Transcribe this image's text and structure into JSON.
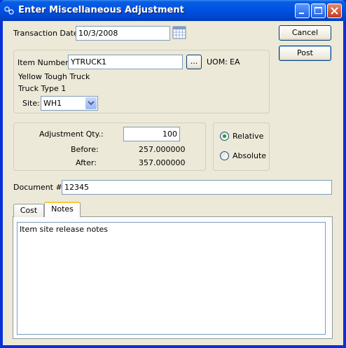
{
  "window": {
    "title": "Enter Miscellaneous Adjustment"
  },
  "transaction_date": {
    "label": "Transaction Date:",
    "value": "10/3/2008"
  },
  "buttons": {
    "cancel": "Cancel",
    "post": "Post",
    "browse": "..."
  },
  "item": {
    "label": "Item Number:",
    "value": "YTRUCK1",
    "uom_label": "UOM:",
    "uom_value": "EA",
    "description1": "Yellow Tough Truck",
    "description2": "Truck Type 1",
    "site_label": "Site:",
    "site_value": "WH1"
  },
  "adjustment": {
    "qty_label": "Adjustment Qty.:",
    "qty_value": "100",
    "before_label": "Before:",
    "before_value": "257.000000",
    "after_label": "After:",
    "after_value": "357.000000"
  },
  "mode": {
    "relative_label": "Relative",
    "absolute_label": "Absolute",
    "selected": "Relative"
  },
  "document": {
    "label": "Document #:",
    "value": "12345"
  },
  "tabs": [
    {
      "label": "Cost",
      "active": false
    },
    {
      "label": "Notes",
      "active": true
    }
  ],
  "notes": {
    "text": "Item site release notes"
  }
}
